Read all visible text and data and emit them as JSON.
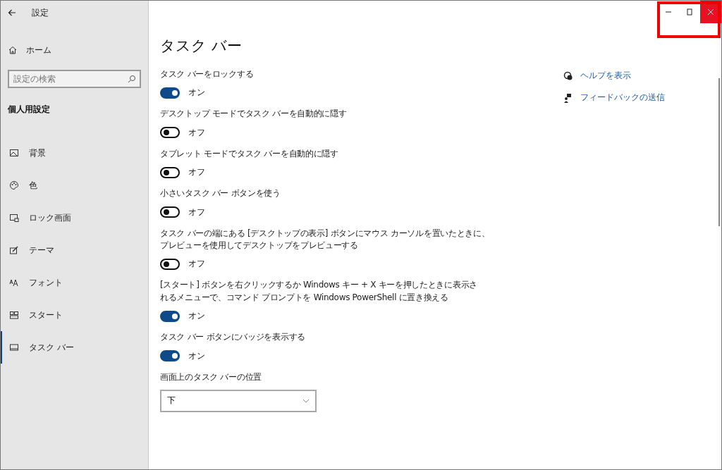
{
  "window": {
    "title": "設定"
  },
  "sidebar": {
    "home": "ホーム",
    "search": {
      "placeholder": "設定の検索"
    },
    "section": "個人用設定",
    "items": [
      {
        "label": "背景",
        "selected": false
      },
      {
        "label": "色",
        "selected": false
      },
      {
        "label": "ロック画面",
        "selected": false
      },
      {
        "label": "テーマ",
        "selected": false
      },
      {
        "label": "フォント",
        "selected": false
      },
      {
        "label": "スタート",
        "selected": false
      },
      {
        "label": "タスク バー",
        "selected": true
      }
    ]
  },
  "page": {
    "title": "タスク バー",
    "settings": [
      {
        "kind": "toggle",
        "lines": [
          "タスク バーをロックする"
        ],
        "on": true,
        "state": "オン"
      },
      {
        "kind": "toggle",
        "lines": [
          "デスクトップ モードでタスク バーを自動的に隠す"
        ],
        "on": false,
        "state": "オフ"
      },
      {
        "kind": "toggle",
        "lines": [
          "タブレット モードでタスク バーを自動的に隠す"
        ],
        "on": false,
        "state": "オフ"
      },
      {
        "kind": "toggle",
        "lines": [
          "小さいタスク バー ボタンを使う"
        ],
        "on": false,
        "state": "オフ"
      },
      {
        "kind": "toggle",
        "lines": [
          "タスク バーの端にある [デスクトップの表示] ボタンにマウス カーソルを置いたときに、",
          "プレビューを使用してデスクトップをプレビューする"
        ],
        "on": false,
        "state": "オフ"
      },
      {
        "kind": "toggle",
        "lines": [
          "[スタート] ボタンを右クリックするか Windows キー + X キーを押したときに表示さ",
          "れるメニューで、コマンド プロンプトを Windows PowerShell に置き換える"
        ],
        "on": true,
        "state": "オン"
      },
      {
        "kind": "toggle",
        "lines": [
          "タスク バー ボタンにバッジを表示する"
        ],
        "on": true,
        "state": "オン"
      },
      {
        "kind": "dropdown",
        "lines": [
          "画面上のタスク バーの位置"
        ],
        "value": "下"
      }
    ]
  },
  "links": [
    {
      "label": "ヘルプを表示"
    },
    {
      "label": "フィードバックの送信"
    }
  ]
}
